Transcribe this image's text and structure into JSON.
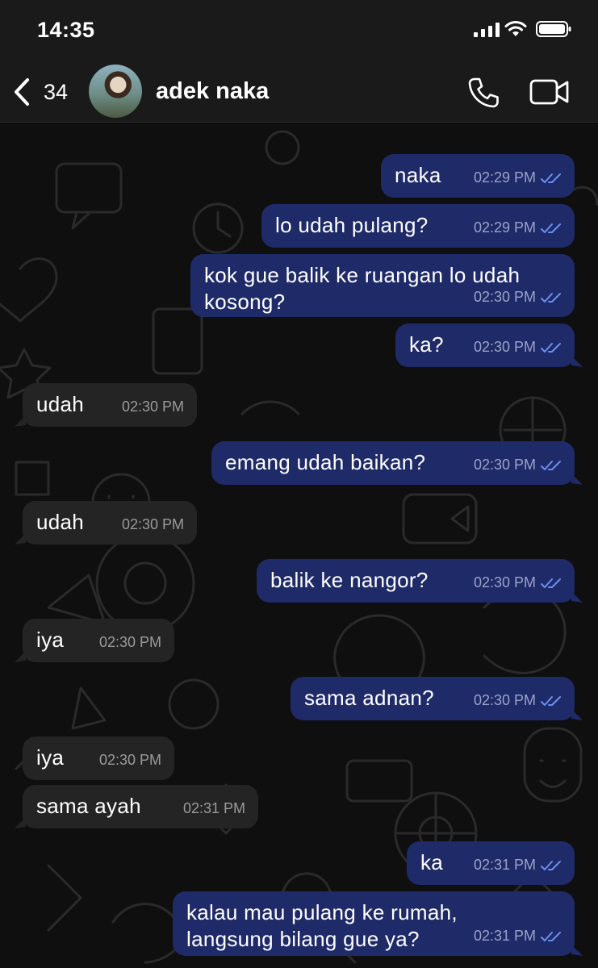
{
  "status_bar": {
    "time": "14:35"
  },
  "header": {
    "back_count": "34",
    "contact_name": "adek naka"
  },
  "colors": {
    "outgoing_bubble": "#1f2a68",
    "incoming_bubble": "#242424",
    "read_ticks": "#6b8ff0",
    "header_bg": "#1a1a1a"
  },
  "messages": [
    {
      "direction": "out",
      "text": "naka",
      "time": "02:29 PM",
      "status": "read"
    },
    {
      "direction": "out",
      "text": "lo udah pulang?",
      "time": "02:29 PM",
      "status": "read"
    },
    {
      "direction": "out",
      "text": "kok gue balik ke ruangan lo udah\nkosong?",
      "time": "02:30 PM",
      "status": "read"
    },
    {
      "direction": "out",
      "text": "ka?",
      "time": "02:30 PM",
      "status": "read"
    },
    {
      "direction": "in",
      "text": "udah",
      "time": "02:30 PM"
    },
    {
      "direction": "out",
      "text": "emang udah baikan?",
      "time": "02:30 PM",
      "status": "read"
    },
    {
      "direction": "in",
      "text": "udah",
      "time": "02:30 PM"
    },
    {
      "direction": "out",
      "text": "balik ke nangor?",
      "time": "02:30 PM",
      "status": "read"
    },
    {
      "direction": "in",
      "text": "iya",
      "time": "02:30 PM"
    },
    {
      "direction": "out",
      "text": "sama adnan?",
      "time": "02:30 PM",
      "status": "read"
    },
    {
      "direction": "in",
      "text": "iya",
      "time": "02:30 PM"
    },
    {
      "direction": "in",
      "text": "sama ayah",
      "time": "02:31 PM"
    },
    {
      "direction": "out",
      "text": "ka",
      "time": "02:31 PM",
      "status": "read"
    },
    {
      "direction": "out",
      "text": "kalau mau pulang ke rumah,\nlangsung bilang gue ya?",
      "time": "02:31 PM",
      "status": "read"
    }
  ]
}
